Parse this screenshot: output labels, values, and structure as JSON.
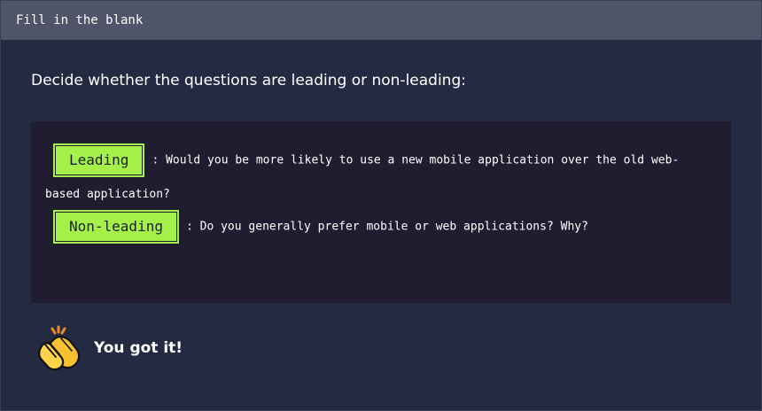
{
  "header": {
    "title": "Fill in the blank"
  },
  "instructions": "Decide whether the questions are leading or non-leading:",
  "items": [
    {
      "answer": "Leading",
      "separator": ":",
      "text": "Would you be more likely to use a new mobile application over the old web-based application?"
    },
    {
      "answer": "Non-leading",
      "separator": ":",
      "text": "Do you generally prefer mobile or web applications? Why?"
    }
  ],
  "feedback": {
    "icon": "clapping-hands-icon",
    "text": "You got it!"
  },
  "colors": {
    "accent": "#a5f14a",
    "background": "#252a43",
    "panel": "#211d30",
    "header": "#4f5468"
  }
}
